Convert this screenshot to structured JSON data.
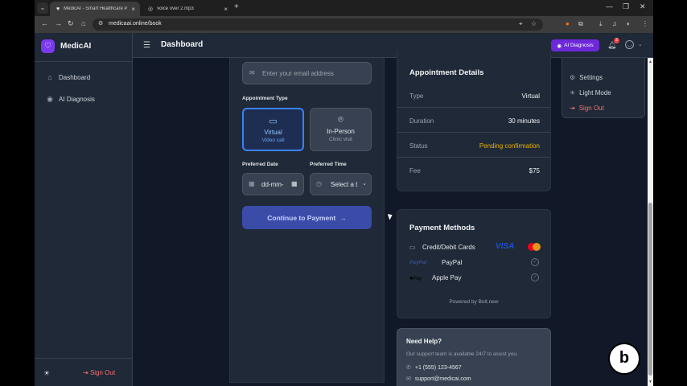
{
  "browser": {
    "tabs": [
      {
        "title": "MedicAI - Smart Healthcare Pla",
        "active": true
      },
      {
        "title": "voice over 2.mp3",
        "active": false
      }
    ],
    "url": "medicaai.online/book"
  },
  "brand": {
    "name": "MedicAI"
  },
  "sidebar": {
    "items": [
      {
        "label": "Dashboard",
        "icon": "home-icon"
      },
      {
        "label": "AI Diagnosis",
        "icon": "brain-icon"
      }
    ],
    "sign_out_label": "Sign Out"
  },
  "header": {
    "title": "Dashboard",
    "ai_button_label": "AI Diagnosis",
    "notification_count": "2"
  },
  "form": {
    "email_placeholder": "Enter your email address",
    "appointment_type_label": "Appointment Type",
    "types": [
      {
        "title": "Virtual",
        "subtitle": "Video call",
        "selected": true
      },
      {
        "title": "In-Person",
        "subtitle": "Clinic visit",
        "selected": false
      }
    ],
    "preferred_date_label": "Preferred Date",
    "date_value": "dd-mm-",
    "preferred_time_label": "Preferred Time",
    "time_value": "Select a t",
    "continue_label": "Continue to Payment"
  },
  "appointment_details": {
    "title": "Appointment Details",
    "rows": [
      {
        "label": "Type",
        "value": "Virtual"
      },
      {
        "label": "Duration",
        "value": "30 minutes"
      },
      {
        "label": "Status",
        "value": "Pending confirmation"
      },
      {
        "label": "Fee",
        "value": "$75"
      }
    ]
  },
  "payment_methods": {
    "title": "Payment Methods",
    "methods": [
      {
        "label": "Credit/Debit Cards",
        "logo": "VISA"
      },
      {
        "label": "PayPal",
        "logo": "PayPal"
      },
      {
        "label": "Apple Pay",
        "logo": "Pay"
      }
    ],
    "powered_by": "Powered by Bolt.new"
  },
  "help": {
    "title": "Need Help?",
    "description": "Our support team is available 24/7 to assist you.",
    "phone": "+1 (555) 123-4567",
    "email": "support@medicai.com"
  },
  "user_menu": {
    "items": [
      {
        "label": "Settings"
      },
      {
        "label": "Light Mode"
      },
      {
        "label": "Sign Out"
      }
    ]
  },
  "colors": {
    "accent": "#3b82f6",
    "brand": "#7c3aed",
    "pending": "#eab308",
    "danger": "#f87171"
  }
}
